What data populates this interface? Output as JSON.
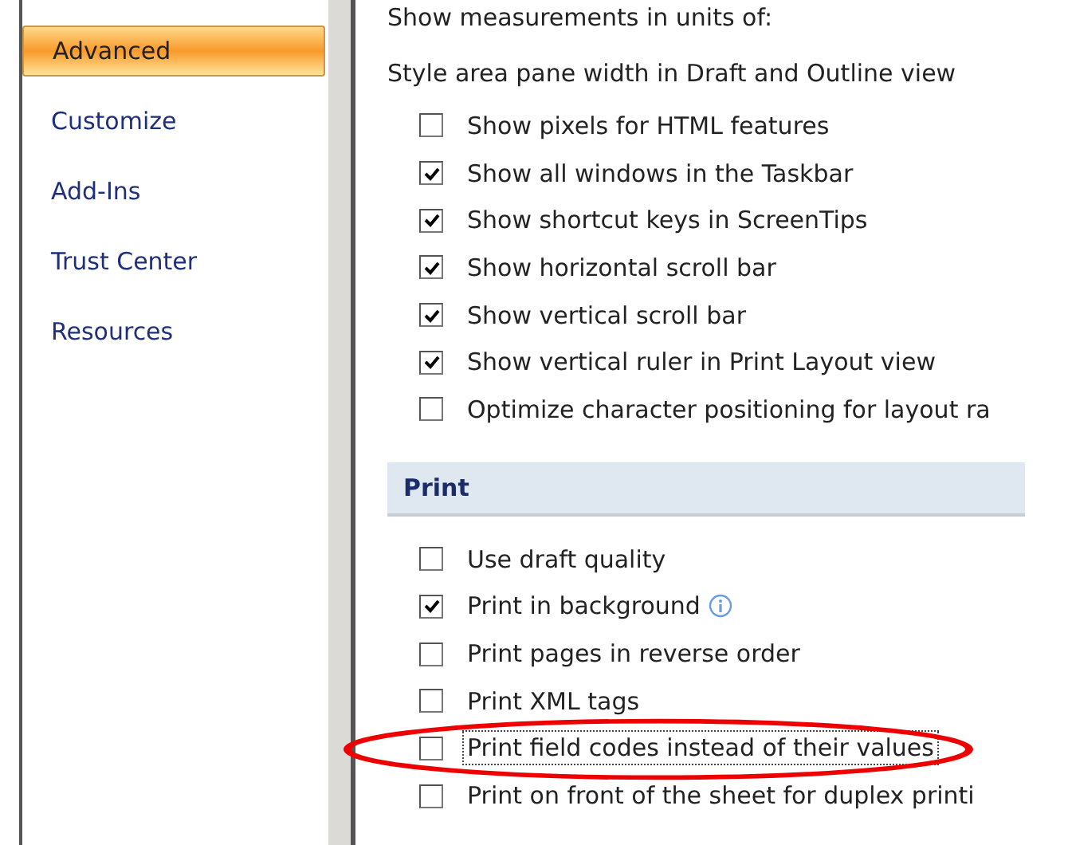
{
  "sidebar": {
    "items": [
      {
        "label": "Advanced",
        "selected": true
      },
      {
        "label": "Customize",
        "selected": false
      },
      {
        "label": "Add-Ins",
        "selected": false
      },
      {
        "label": "Trust Center",
        "selected": false
      },
      {
        "label": "Resources",
        "selected": false
      }
    ]
  },
  "display": {
    "labels": [
      "Show measurements in units of:",
      "Style area pane width in Draft and Outline view"
    ],
    "options": [
      {
        "label": "Show pixels for HTML features",
        "checked": false
      },
      {
        "label": "Show all windows in the Taskbar",
        "checked": true
      },
      {
        "label": "Show shortcut keys in ScreenTips",
        "checked": true
      },
      {
        "label": "Show horizontal scroll bar",
        "checked": true
      },
      {
        "label": "Show vertical scroll bar",
        "checked": true
      },
      {
        "label": "Show vertical ruler in Print Layout view",
        "checked": true
      },
      {
        "label": "Optimize character positioning for layout ra",
        "checked": false
      }
    ]
  },
  "print": {
    "title": "Print",
    "options": [
      {
        "label": "Use draft quality",
        "checked": false,
        "info": false,
        "focused": false,
        "circled": false
      },
      {
        "label": "Print in background",
        "checked": true,
        "info": true,
        "focused": false,
        "circled": false
      },
      {
        "label": "Print pages in reverse order",
        "checked": false,
        "info": false,
        "focused": false,
        "circled": false
      },
      {
        "label": "Print XML tags",
        "checked": false,
        "info": false,
        "focused": false,
        "circled": false
      },
      {
        "label": "Print field codes instead of their values",
        "checked": false,
        "info": false,
        "focused": true,
        "circled": true
      },
      {
        "label": "Print on front of the sheet for duplex printi",
        "checked": false,
        "info": false,
        "focused": false,
        "circled": false
      }
    ]
  }
}
